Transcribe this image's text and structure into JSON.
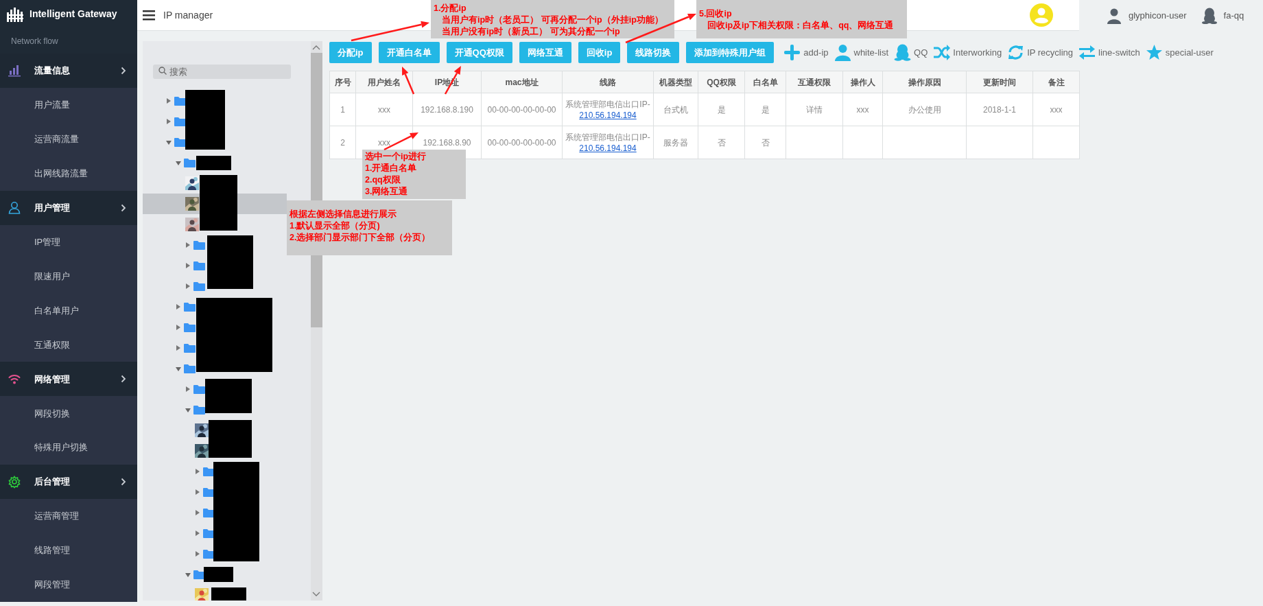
{
  "sidebar": {
    "brand": "Intelligent Gateway",
    "section_label": "Network flow",
    "groups": [
      {
        "title": "流量信息",
        "items": [
          "用户流量",
          "运营商流量",
          "出网线路流量"
        ]
      },
      {
        "title": "用户管理",
        "items": [
          "IP管理",
          "限速用户",
          "白名单用户",
          "互通权限"
        ]
      },
      {
        "title": "网络管理",
        "items": [
          "网段切换",
          "特殊用户切换"
        ]
      },
      {
        "title": "后台管理",
        "items": [
          "运营商管理",
          "线路管理",
          "网段管理"
        ]
      }
    ]
  },
  "topbar": {
    "title": "IP manager",
    "user_links": [
      "glyphicon-user",
      "fa-qq"
    ]
  },
  "tree": {
    "search_placeholder": "搜索",
    "nodes": [
      {
        "kind": "folder",
        "expanded": false,
        "selected": false
      },
      {
        "kind": "folder",
        "expanded": false,
        "selected": false
      },
      {
        "kind": "folder",
        "expanded": true,
        "selected": false,
        "children": [
          {
            "kind": "folder",
            "expanded": true,
            "selected": false,
            "children": [
              {
                "kind": "user",
                "selected": false
              },
              {
                "kind": "user",
                "selected": true
              },
              {
                "kind": "user",
                "selected": false
              },
              {
                "kind": "folder",
                "expanded": false,
                "selected": false
              },
              {
                "kind": "folder",
                "expanded": false,
                "selected": false
              },
              {
                "kind": "folder",
                "expanded": false,
                "selected": false
              }
            ]
          },
          {
            "kind": "folder",
            "expanded": false,
            "selected": false
          },
          {
            "kind": "folder",
            "expanded": false,
            "selected": false
          },
          {
            "kind": "folder",
            "expanded": false,
            "selected": false
          },
          {
            "kind": "folder",
            "expanded": true,
            "selected": false,
            "children": [
              {
                "kind": "folder",
                "expanded": false,
                "selected": false
              },
              {
                "kind": "folder",
                "expanded": true,
                "selected": false,
                "children": [
                  {
                    "kind": "user",
                    "selected": false
                  },
                  {
                    "kind": "user",
                    "selected": false
                  },
                  {
                    "kind": "folder",
                    "expanded": false,
                    "selected": false
                  },
                  {
                    "kind": "folder",
                    "expanded": false,
                    "selected": false
                  },
                  {
                    "kind": "folder",
                    "expanded": false,
                    "selected": false
                  },
                  {
                    "kind": "folder",
                    "expanded": false,
                    "selected": false
                  },
                  {
                    "kind": "folder",
                    "expanded": false,
                    "selected": false
                  }
                ]
              },
              {
                "kind": "folder",
                "expanded": true,
                "selected": false,
                "children": [
                  {
                    "kind": "user",
                    "selected": false
                  }
                ]
              }
            ]
          }
        ]
      }
    ]
  },
  "toolbar": {
    "buttons": [
      "分配ip",
      "开通白名单",
      "开通QQ权限",
      "网络互通",
      "回收ip",
      "线路切换",
      "添加到特殊用户组"
    ],
    "legend": [
      "add-ip",
      "white-list",
      "QQ",
      "Interworking",
      "IP recycling",
      "line-switch",
      "special-user"
    ]
  },
  "table": {
    "columns": [
      "序号",
      "用户姓名",
      "IP地址",
      "mac地址",
      "线路",
      "机器类型",
      "QQ权限",
      "白名单",
      "互通权限",
      "操作人",
      "操作原因",
      "更新时间",
      "备注"
    ],
    "rows": [
      {
        "cells": [
          "1",
          "xxx",
          "192.168.8.190",
          "00-00-00-00-00-00",
          {
            "text": "系统管理部电信出口IP-",
            "link": "210.56.194.194"
          },
          "台式机",
          "是",
          "是",
          "详情",
          "xxx",
          "办公使用",
          "2018-1-1",
          "xxx"
        ]
      },
      {
        "cells": [
          "2",
          "xxx",
          "192.168.8.90",
          "00-00-00-00-00-00",
          {
            "text": "系统管理部电信出口IP-",
            "link": "210.56.194.194"
          },
          "服务器",
          "否",
          "否",
          "",
          "",
          "",
          "",
          ""
        ]
      }
    ]
  },
  "annotations": [
    {
      "title": "1.分配ip",
      "lines": [
        "当用户有ip时（老员工）  可再分配一个ip（外挂ip功能）",
        "当用户没有ip时（新员工） 可为其分配一个ip"
      ]
    },
    {
      "title": "5.回收ip",
      "lines": [
        "回收ip及ip下相关权限：白名单、qq、网络互通"
      ]
    },
    {
      "title": "选中一个ip进行",
      "lines": [
        "1.开通白名单",
        "2.qq权限",
        "3.网络互通"
      ]
    },
    {
      "title": "根据左侧选择信息进行展示",
      "lines": [
        "1.默认显示全部（分页)",
        "2.选择部门显示部门下全部（分页）"
      ]
    }
  ]
}
